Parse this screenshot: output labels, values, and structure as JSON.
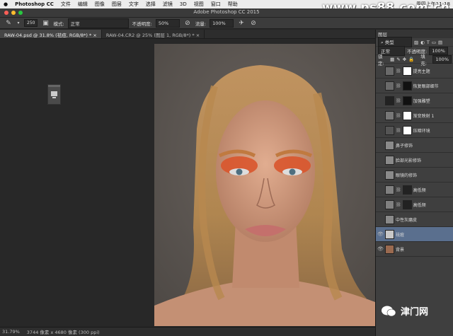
{
  "menubar": {
    "apple": "",
    "app": "Photoshop CC",
    "items": [
      "文件",
      "编辑",
      "图像",
      "图层",
      "文字",
      "选择",
      "滤镜",
      "3D",
      "视图",
      "窗口",
      "帮助"
    ],
    "clock": "周四上午11:18"
  },
  "watermark": "www.ps88.com.cn",
  "titlebar": {
    "title": "Adobe Photoshop CC 2015"
  },
  "options": {
    "brush_size": "250",
    "mode_label": "模式:",
    "mode_value": "正常",
    "opacity_label": "不透明度:",
    "opacity_value": "50%",
    "flow_label": "流量:",
    "flow_value": "100%"
  },
  "tabs": [
    {
      "label": "RAW-04.psd @ 31.8% (祛痘, RGB/8*) *"
    },
    {
      "label": "RAW-04.CR2 @ 25% (图层 1, RGB/8*) *"
    }
  ],
  "status": {
    "zoom": "31.79%",
    "doc": "3744 像素 x 4680 像素 (300 ppi)"
  },
  "panel": {
    "title": "图层",
    "filter": "类型",
    "blend": "正常",
    "opacity_label": "不透明度:",
    "opacity_value": "100%",
    "lock_label": "锁定:",
    "fill_label": "填充:",
    "fill_value": "100%",
    "layers": [
      {
        "name": "提亮主题",
        "visible": false,
        "thumb": "#6a6a6a",
        "mask": "#ffffff"
      },
      {
        "name": "恢复眼部细节",
        "visible": false,
        "thumb": "#6a6a6a",
        "mask": "#111111"
      },
      {
        "name": "加强雕塑",
        "visible": false,
        "thumb": "#222222",
        "mask": "#111111"
      },
      {
        "name": "渐变映射 1",
        "visible": false,
        "thumb": "#777777",
        "mask": "#ffffff"
      },
      {
        "name": "压暗环境",
        "visible": false,
        "thumb": "#555555",
        "mask": "#ffffff"
      },
      {
        "name": "鼻子修饰",
        "visible": false,
        "thumb": "#8a8a8a",
        "mask": ""
      },
      {
        "name": "脸部光影修饰",
        "visible": false,
        "thumb": "#8a8a8a",
        "mask": ""
      },
      {
        "name": "眼镜的修饰",
        "visible": false,
        "thumb": "#8a8a8a",
        "mask": ""
      },
      {
        "name": "高低频",
        "visible": false,
        "thumb": "#808080",
        "mask": "#222222"
      },
      {
        "name": "高低频",
        "visible": false,
        "thumb": "#808080",
        "mask": "#222222"
      },
      {
        "name": "中性灰磨皮",
        "visible": false,
        "thumb": "#8a8a8a",
        "mask": ""
      },
      {
        "name": "祛痘",
        "visible": true,
        "thumb": "#c8c8c8",
        "mask": "",
        "selected": true
      },
      {
        "name": "背景",
        "visible": true,
        "thumb": "#9a6a50",
        "mask": ""
      }
    ]
  },
  "footer_brand": "津门网"
}
